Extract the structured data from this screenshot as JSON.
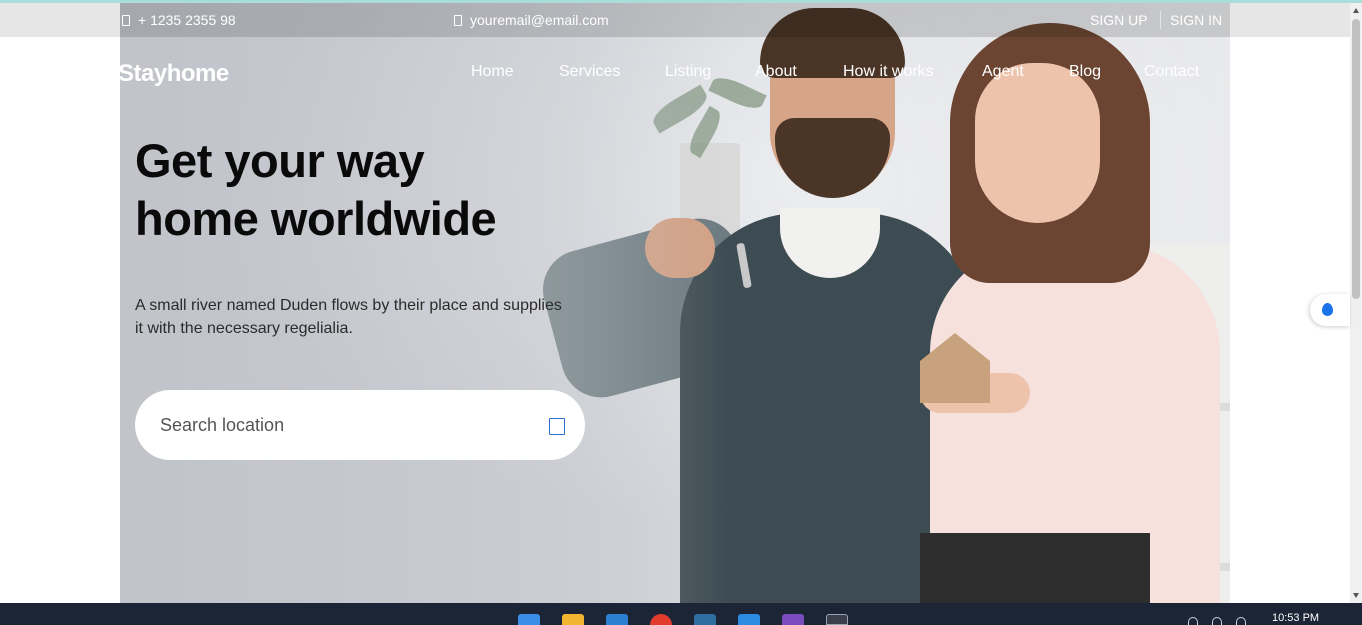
{
  "topbar": {
    "phone": "+ 1235 2355 98",
    "email": "youremail@email.com",
    "signup": "SIGN UP",
    "signin": "SIGN IN",
    "phone_icon": "phone-icon",
    "email_icon": "paper-plane-icon"
  },
  "brand": {
    "logo": "Stayhome"
  },
  "nav": {
    "items": [
      {
        "label": "Home"
      },
      {
        "label": "Services"
      },
      {
        "label": "Listing"
      },
      {
        "label": "About"
      },
      {
        "label": "How it works"
      },
      {
        "label": "Agent"
      },
      {
        "label": "Blog"
      },
      {
        "label": "Contact"
      }
    ]
  },
  "hero": {
    "title_line1": "Get your way",
    "title_line2": "home worldwide",
    "subtitle": "A small river named Duden flows by their place and supplies it with the necessary regelialia.",
    "image": "couple-holding-keys-and-house-model"
  },
  "search": {
    "placeholder": "Search location",
    "value": "",
    "icon": "search-icon"
  },
  "system": {
    "clock": "10:53 PM",
    "floating_widget_icon": "water-drop-icon"
  },
  "colors": {
    "search_icon": "#2f6fd0",
    "taskbar": "#1c2536",
    "accent_line": "#a8ddd9"
  }
}
